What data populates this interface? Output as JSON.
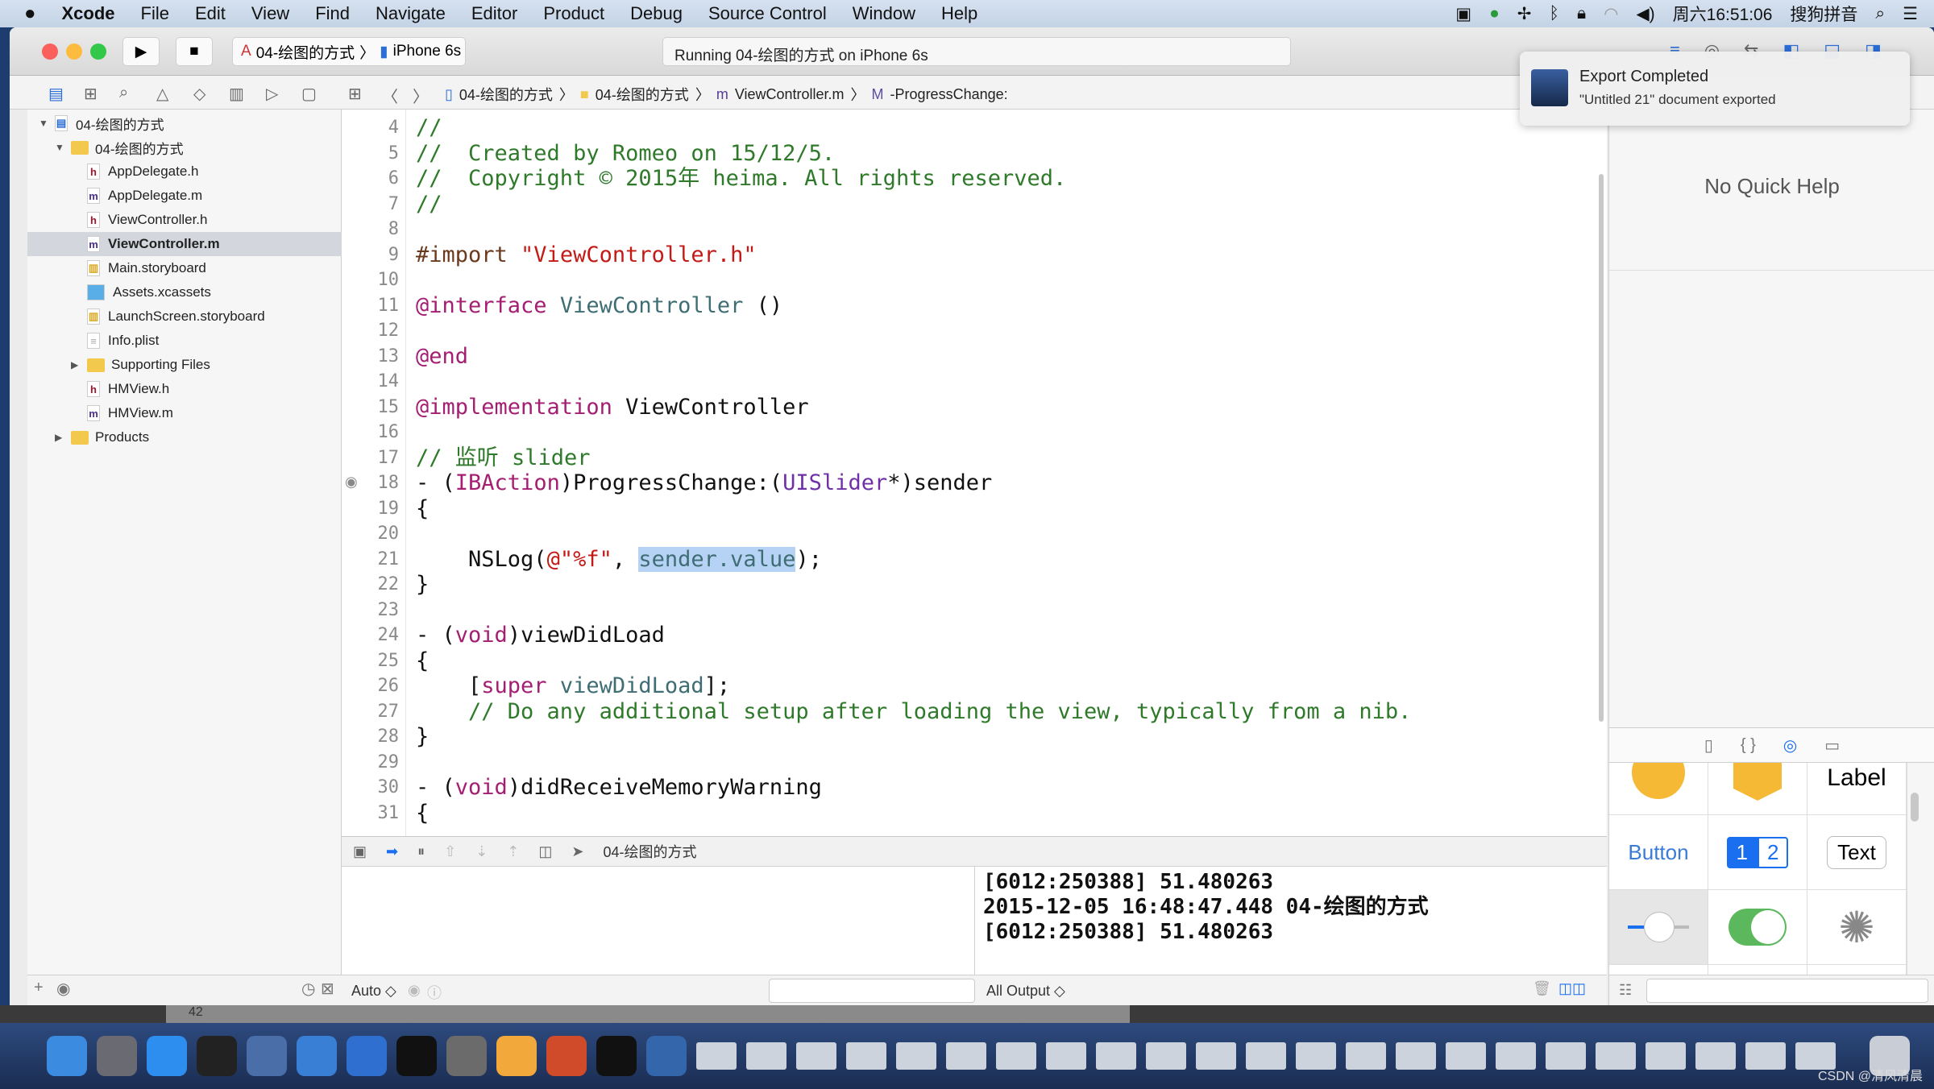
{
  "menubar": {
    "apple": "",
    "items": [
      "Xcode",
      "File",
      "Edit",
      "View",
      "Find",
      "Navigate",
      "Editor",
      "Product",
      "Debug",
      "Source Control",
      "Window",
      "Help"
    ],
    "clock": "周六16:51:06",
    "ime": "搜狗拼音"
  },
  "toolbar": {
    "scheme": "04-绘图的方式",
    "device": "iPhone 6s",
    "activity": "Running 04-绘图的方式 on iPhone 6s"
  },
  "jumpbar": [
    "04-绘图的方式",
    "04-绘图的方式",
    "ViewController.m",
    "-ProgressChange:"
  ],
  "navigator": {
    "items": [
      {
        "label": "04-绘图的方式",
        "type": "project",
        "level": 0,
        "open": true
      },
      {
        "label": "04-绘图的方式",
        "type": "folder",
        "level": 1,
        "open": true
      },
      {
        "label": "AppDelegate.h",
        "type": "h",
        "level": 2
      },
      {
        "label": "AppDelegate.m",
        "type": "m",
        "level": 2
      },
      {
        "label": "ViewController.h",
        "type": "h",
        "level": 2
      },
      {
        "label": "ViewController.m",
        "type": "m",
        "level": 2,
        "selected": true
      },
      {
        "label": "Main.storyboard",
        "type": "sb",
        "level": 2
      },
      {
        "label": "Assets.xcassets",
        "type": "assets",
        "level": 2
      },
      {
        "label": "LaunchScreen.storyboard",
        "type": "sb",
        "level": 2
      },
      {
        "label": "Info.plist",
        "type": "plist",
        "level": 2
      },
      {
        "label": "Supporting Files",
        "type": "folder",
        "level": 2,
        "open": false
      },
      {
        "label": "HMView.h",
        "type": "h",
        "level": 2
      },
      {
        "label": "HMView.m",
        "type": "m",
        "level": 2
      },
      {
        "label": "Products",
        "type": "folder",
        "level": 1,
        "open": false
      }
    ]
  },
  "code": {
    "first_line": 4,
    "breakpoint_line": 18,
    "lines": [
      [
        [
          "//",
          "comment"
        ]
      ],
      [
        [
          "//  Created by Romeo on 15/12/5.",
          "comment"
        ]
      ],
      [
        [
          "//  Copyright © 2015年 heima. All rights reserved.",
          "comment"
        ]
      ],
      [
        [
          "//",
          "comment"
        ]
      ],
      [],
      [
        [
          "#import ",
          "pre"
        ],
        [
          "\"ViewController.h\"",
          "str"
        ]
      ],
      [],
      [
        [
          "@interface ",
          "kw"
        ],
        [
          "ViewController",
          "cls"
        ],
        [
          " ()",
          "plain"
        ]
      ],
      [],
      [
        [
          "@end",
          "kw"
        ]
      ],
      [],
      [
        [
          "@implementation ",
          "kw"
        ],
        [
          "ViewController",
          "plain"
        ]
      ],
      [],
      [
        [
          "// 监听 slider",
          "comment"
        ]
      ],
      [
        [
          "- (",
          "plain"
        ],
        [
          "IBAction",
          "kw"
        ],
        [
          ")ProgressChange:(",
          "plain"
        ],
        [
          "UISlider",
          "type"
        ],
        [
          "*)sender",
          "plain"
        ]
      ],
      [
        [
          "{",
          "plain"
        ]
      ],
      [],
      [
        [
          "    NSLog(",
          "plain"
        ],
        [
          "@\"%f\"",
          "str"
        ],
        [
          ", ",
          "plain"
        ],
        [
          "sender.value",
          "sel"
        ],
        [
          ");",
          "plain"
        ]
      ],
      [
        [
          "}",
          "plain"
        ]
      ],
      [],
      [
        [
          "- (",
          "plain"
        ],
        [
          "void",
          "kw"
        ],
        [
          ")viewDidLoad",
          "plain"
        ]
      ],
      [
        [
          "{",
          "plain"
        ]
      ],
      [
        [
          "    [",
          "plain"
        ],
        [
          "super",
          "kw"
        ],
        [
          " viewDidLoad",
          "cls"
        ],
        [
          "];",
          "plain"
        ]
      ],
      [
        [
          "    // Do any additional setup after loading the view, typically from a nib.",
          "comment"
        ]
      ],
      [
        [
          "}",
          "plain"
        ]
      ],
      [],
      [
        [
          "- (",
          "plain"
        ],
        [
          "void",
          "kw"
        ],
        [
          ")didReceiveMemoryWarning",
          "plain"
        ]
      ],
      [
        [
          "{",
          "plain"
        ]
      ]
    ]
  },
  "debug": {
    "target": "04-绘图的方式",
    "auto": "Auto ◇",
    "output_filter": "All Output ◇",
    "console": [
      "[6012:250388] 51.480263",
      "2015-12-05 16:48:47.448 04-绘图的方式",
      "[6012:250388] 51.480263"
    ]
  },
  "inspector": {
    "quick_help": "No Quick Help",
    "library": {
      "label": "Label",
      "button": "Button",
      "seg1": "1",
      "seg2": "2",
      "text": "Text"
    }
  },
  "notification": {
    "title": "Export Completed",
    "body": "\"Untitled 21\" document exported"
  },
  "scroll_label": "42",
  "dock": [
    "finder",
    "launchpad",
    "safari",
    "mouse",
    "preview",
    "xcode",
    "keynote",
    "terminal",
    "system-preferences",
    "sketch",
    "powerpoint",
    "terminal-black",
    "quicktime"
  ],
  "watermark": "CSDN @清风清晨",
  "colors": {
    "accent": "#1a6ff0",
    "comment": "#2f7a2a",
    "keyword": "#a41e72",
    "string": "#c41a16",
    "class": "#3e6e74"
  }
}
